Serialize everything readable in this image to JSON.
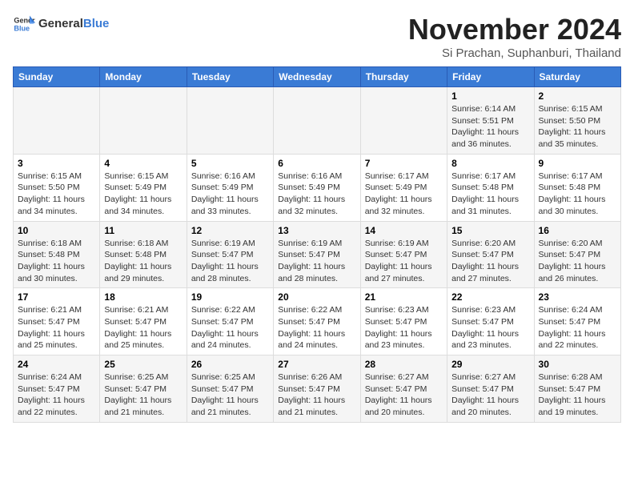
{
  "header": {
    "logo_general": "General",
    "logo_blue": "Blue",
    "month_title": "November 2024",
    "subtitle": "Si Prachan, Suphanburi, Thailand"
  },
  "weekdays": [
    "Sunday",
    "Monday",
    "Tuesday",
    "Wednesday",
    "Thursday",
    "Friday",
    "Saturday"
  ],
  "weeks": [
    [
      {
        "day": "",
        "detail": ""
      },
      {
        "day": "",
        "detail": ""
      },
      {
        "day": "",
        "detail": ""
      },
      {
        "day": "",
        "detail": ""
      },
      {
        "day": "",
        "detail": ""
      },
      {
        "day": "1",
        "detail": "Sunrise: 6:14 AM\nSunset: 5:51 PM\nDaylight: 11 hours and 36 minutes."
      },
      {
        "day": "2",
        "detail": "Sunrise: 6:15 AM\nSunset: 5:50 PM\nDaylight: 11 hours and 35 minutes."
      }
    ],
    [
      {
        "day": "3",
        "detail": "Sunrise: 6:15 AM\nSunset: 5:50 PM\nDaylight: 11 hours and 34 minutes."
      },
      {
        "day": "4",
        "detail": "Sunrise: 6:15 AM\nSunset: 5:49 PM\nDaylight: 11 hours and 34 minutes."
      },
      {
        "day": "5",
        "detail": "Sunrise: 6:16 AM\nSunset: 5:49 PM\nDaylight: 11 hours and 33 minutes."
      },
      {
        "day": "6",
        "detail": "Sunrise: 6:16 AM\nSunset: 5:49 PM\nDaylight: 11 hours and 32 minutes."
      },
      {
        "day": "7",
        "detail": "Sunrise: 6:17 AM\nSunset: 5:49 PM\nDaylight: 11 hours and 32 minutes."
      },
      {
        "day": "8",
        "detail": "Sunrise: 6:17 AM\nSunset: 5:48 PM\nDaylight: 11 hours and 31 minutes."
      },
      {
        "day": "9",
        "detail": "Sunrise: 6:17 AM\nSunset: 5:48 PM\nDaylight: 11 hours and 30 minutes."
      }
    ],
    [
      {
        "day": "10",
        "detail": "Sunrise: 6:18 AM\nSunset: 5:48 PM\nDaylight: 11 hours and 30 minutes."
      },
      {
        "day": "11",
        "detail": "Sunrise: 6:18 AM\nSunset: 5:48 PM\nDaylight: 11 hours and 29 minutes."
      },
      {
        "day": "12",
        "detail": "Sunrise: 6:19 AM\nSunset: 5:47 PM\nDaylight: 11 hours and 28 minutes."
      },
      {
        "day": "13",
        "detail": "Sunrise: 6:19 AM\nSunset: 5:47 PM\nDaylight: 11 hours and 28 minutes."
      },
      {
        "day": "14",
        "detail": "Sunrise: 6:19 AM\nSunset: 5:47 PM\nDaylight: 11 hours and 27 minutes."
      },
      {
        "day": "15",
        "detail": "Sunrise: 6:20 AM\nSunset: 5:47 PM\nDaylight: 11 hours and 27 minutes."
      },
      {
        "day": "16",
        "detail": "Sunrise: 6:20 AM\nSunset: 5:47 PM\nDaylight: 11 hours and 26 minutes."
      }
    ],
    [
      {
        "day": "17",
        "detail": "Sunrise: 6:21 AM\nSunset: 5:47 PM\nDaylight: 11 hours and 25 minutes."
      },
      {
        "day": "18",
        "detail": "Sunrise: 6:21 AM\nSunset: 5:47 PM\nDaylight: 11 hours and 25 minutes."
      },
      {
        "day": "19",
        "detail": "Sunrise: 6:22 AM\nSunset: 5:47 PM\nDaylight: 11 hours and 24 minutes."
      },
      {
        "day": "20",
        "detail": "Sunrise: 6:22 AM\nSunset: 5:47 PM\nDaylight: 11 hours and 24 minutes."
      },
      {
        "day": "21",
        "detail": "Sunrise: 6:23 AM\nSunset: 5:47 PM\nDaylight: 11 hours and 23 minutes."
      },
      {
        "day": "22",
        "detail": "Sunrise: 6:23 AM\nSunset: 5:47 PM\nDaylight: 11 hours and 23 minutes."
      },
      {
        "day": "23",
        "detail": "Sunrise: 6:24 AM\nSunset: 5:47 PM\nDaylight: 11 hours and 22 minutes."
      }
    ],
    [
      {
        "day": "24",
        "detail": "Sunrise: 6:24 AM\nSunset: 5:47 PM\nDaylight: 11 hours and 22 minutes."
      },
      {
        "day": "25",
        "detail": "Sunrise: 6:25 AM\nSunset: 5:47 PM\nDaylight: 11 hours and 21 minutes."
      },
      {
        "day": "26",
        "detail": "Sunrise: 6:25 AM\nSunset: 5:47 PM\nDaylight: 11 hours and 21 minutes."
      },
      {
        "day": "27",
        "detail": "Sunrise: 6:26 AM\nSunset: 5:47 PM\nDaylight: 11 hours and 21 minutes."
      },
      {
        "day": "28",
        "detail": "Sunrise: 6:27 AM\nSunset: 5:47 PM\nDaylight: 11 hours and 20 minutes."
      },
      {
        "day": "29",
        "detail": "Sunrise: 6:27 AM\nSunset: 5:47 PM\nDaylight: 11 hours and 20 minutes."
      },
      {
        "day": "30",
        "detail": "Sunrise: 6:28 AM\nSunset: 5:47 PM\nDaylight: 11 hours and 19 minutes."
      }
    ]
  ]
}
